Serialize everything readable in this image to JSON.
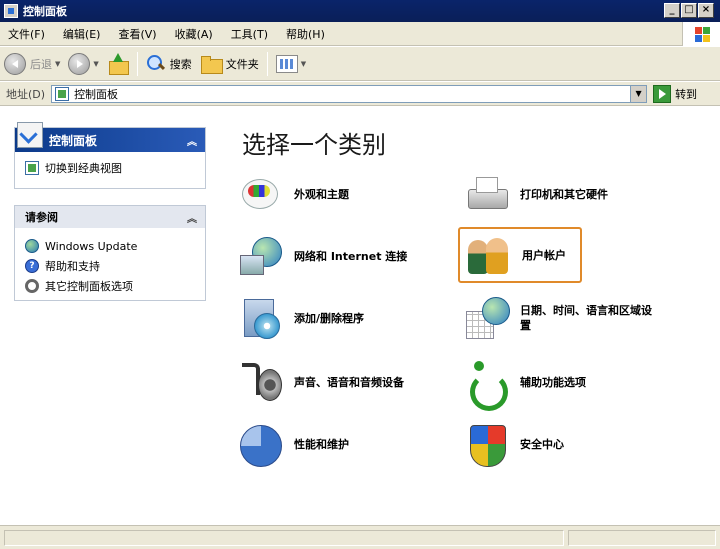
{
  "window": {
    "title": "控制面板"
  },
  "menu": [
    "文件(F)",
    "编辑(E)",
    "查看(V)",
    "收藏(A)",
    "工具(T)",
    "帮助(H)"
  ],
  "toolbar": {
    "back": "后退",
    "search": "搜索",
    "folders": "文件夹"
  },
  "address": {
    "label": "地址(D)",
    "value": "控制面板",
    "go": "转到"
  },
  "sidebar": {
    "panel1": {
      "title": "控制面板",
      "link": "切换到经典视图"
    },
    "panel2": {
      "title": "请参阅",
      "links": [
        "Windows Update",
        "帮助和支持",
        "其它控制面板选项"
      ]
    }
  },
  "main": {
    "title": "选择一个类别",
    "categories": [
      "外观和主题",
      "打印机和其它硬件",
      "网络和 Internet 连接",
      "用户帐户",
      "添加/删除程序",
      "日期、时间、语言和区域设",
      "置",
      "声音、语音和音频设备",
      "辅助功能选项",
      "性能和维护",
      "安全中心"
    ],
    "selected": "用户帐户"
  },
  "colors": {
    "title_bar": "#0a246a",
    "selection_border": "#e08a2a",
    "panel_header": "#0c3a8a"
  }
}
